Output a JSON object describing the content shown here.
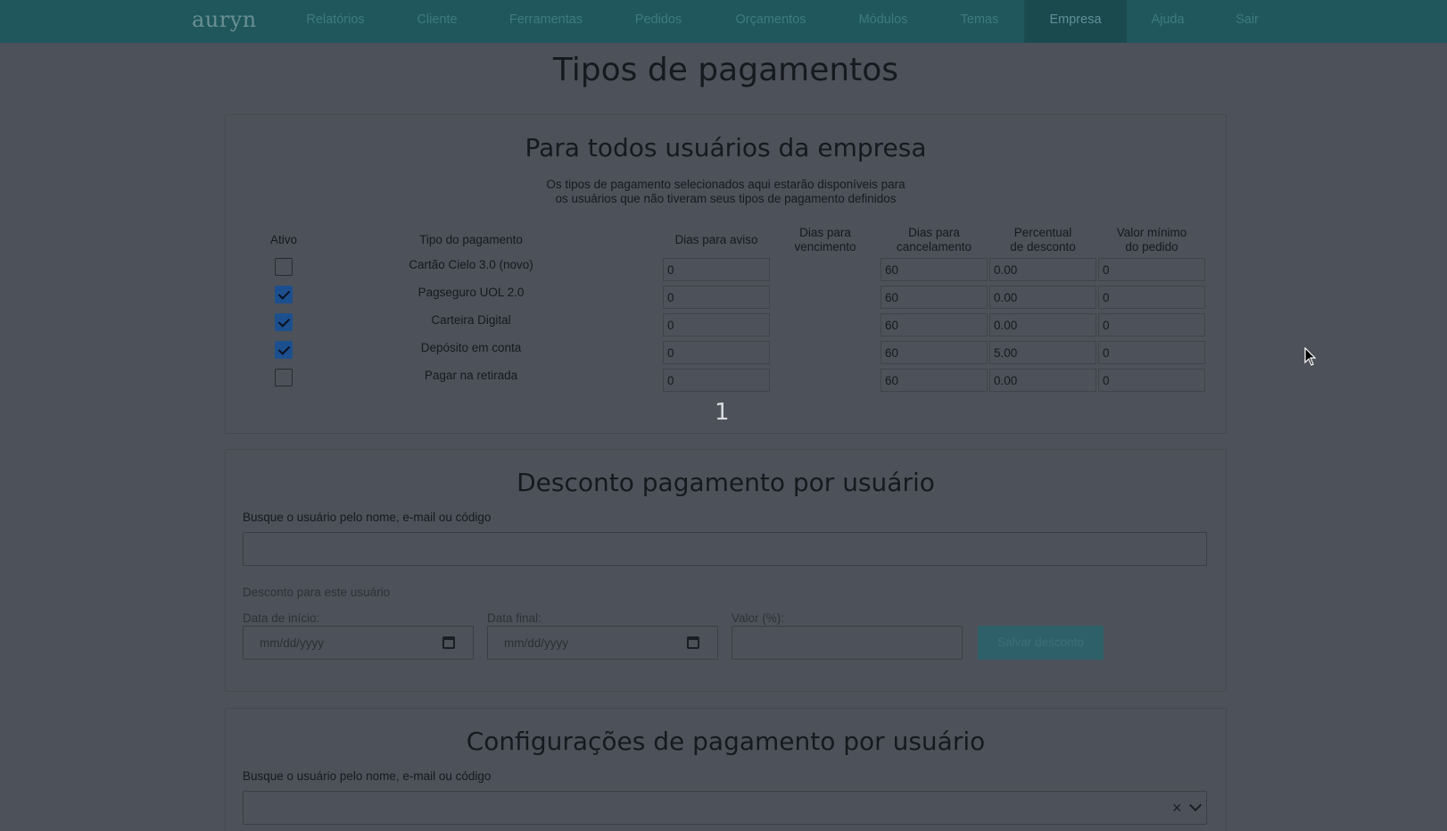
{
  "navbar": {
    "brand": "auryn",
    "items": [
      {
        "label": "Relatórios"
      },
      {
        "label": "Cliente"
      },
      {
        "label": "Ferramentas"
      },
      {
        "label": "Pedidos"
      },
      {
        "label": "Orçamentos"
      },
      {
        "label": "Módulos"
      },
      {
        "label": "Temas"
      },
      {
        "label": "Empresa",
        "active": true
      },
      {
        "label": "Ajuda"
      },
      {
        "label": "Sair"
      }
    ]
  },
  "page": {
    "title": "Tipos de pagamentos"
  },
  "company_section": {
    "title": "Para todos usuários da empresa",
    "subtitle_line1": "Os tipos de pagamento selecionados aqui estarão disponíveis para",
    "subtitle_line2": "os usuários que não tiveram seus tipos de pagamento definidos",
    "columns": {
      "active": "Ativo",
      "type": "Tipo do pagamento",
      "notice_days": "Dias para aviso",
      "due_days_1": "Dias para",
      "due_days_2": "vencimento",
      "cancel_days_1": "Dias para",
      "cancel_days_2": "cancelamento",
      "discount_1": "Percentual",
      "discount_2": "de desconto",
      "min_value_1": "Valor mínimo",
      "min_value_2": "do pedido"
    },
    "rows": [
      {
        "active": false,
        "type": "Cartão Cielo 3.0 (novo)",
        "notice_days": "0",
        "cancel_days": "60",
        "discount": "0.00",
        "min_value": "0"
      },
      {
        "active": true,
        "type": "Pagseguro UOL 2.0",
        "notice_days": "0",
        "cancel_days": "60",
        "discount": "0.00",
        "min_value": "0"
      },
      {
        "active": true,
        "type": "Carteira Digital",
        "notice_days": "0",
        "cancel_days": "60",
        "discount": "0.00",
        "min_value": "0"
      },
      {
        "active": true,
        "type": "Depósito em conta",
        "notice_days": "0",
        "cancel_days": "60",
        "discount": "5.00",
        "min_value": "0"
      },
      {
        "active": false,
        "type": "Pagar na retirada",
        "notice_days": "0",
        "cancel_days": "60",
        "discount": "0.00",
        "min_value": "0"
      }
    ],
    "pager": "1"
  },
  "user_discount_section": {
    "title": "Desconto pagamento por usuário",
    "search_label": "Busque o usuário pelo nome, e-mail ou código",
    "search_value": "",
    "discount_label": "Desconto para este usuário",
    "start_label": "Data de início:",
    "start_placeholder": "mm/dd/yyyy",
    "end_label": "Data final:",
    "end_placeholder": "mm/dd/yyyy",
    "value_label": "Valor (%):",
    "value_value": "",
    "save_label": "Salvar desconto"
  },
  "user_config_section": {
    "title": "Configurações de pagamento por usuário",
    "search_label": "Busque o usuário pelo nome, e-mail ou código",
    "clear_glyph": "×"
  },
  "colors": {
    "navbar": "#1f575c",
    "navbar_active": "#1a4a4e",
    "checkbox_checked": "#1c4f8e",
    "save_button": "#2e6069"
  }
}
